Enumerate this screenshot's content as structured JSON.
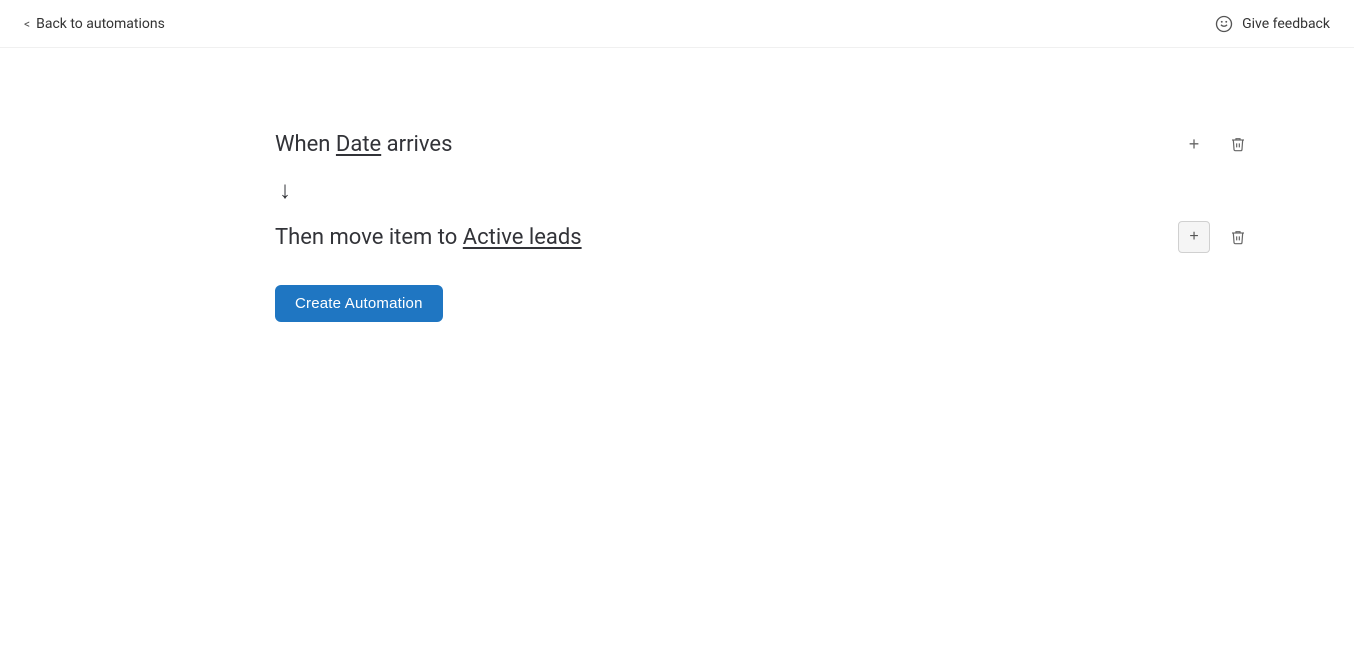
{
  "topbar": {
    "back_label": "Back to automations",
    "feedback_label": "Give feedback"
  },
  "automation": {
    "when_prefix": "When ",
    "when_trigger": "Date",
    "when_suffix": " arrives",
    "arrow": "↓",
    "then_prefix": "Then move item to ",
    "then_destination": "Active leads",
    "create_button_label": "Create Automation"
  },
  "actions": {
    "add_label": "+",
    "delete_label": "🗑"
  }
}
